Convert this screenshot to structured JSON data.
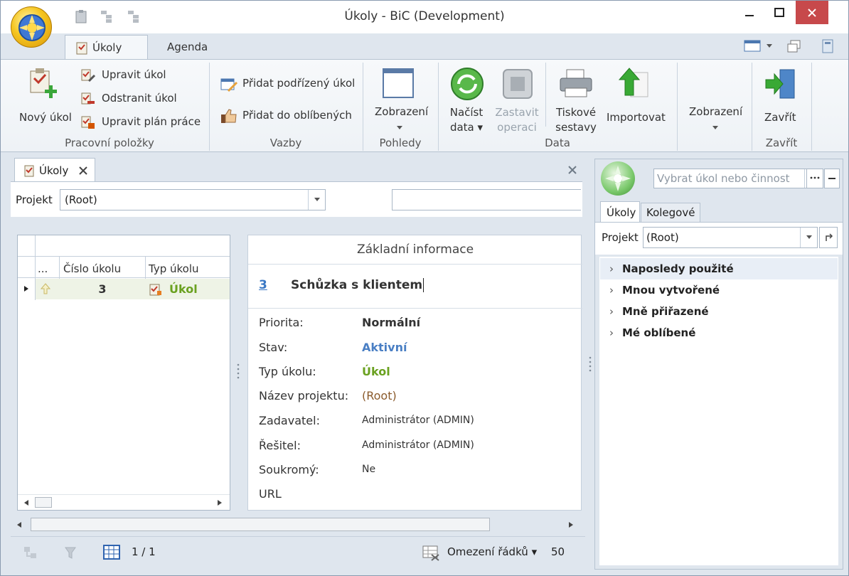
{
  "window": {
    "title": "Úkoly - BiC (Development)"
  },
  "ribbon": {
    "tabs": [
      {
        "label": "Úkoly"
      },
      {
        "label": "Agenda"
      }
    ],
    "groups": {
      "pracovni": {
        "label": "Pracovní položky",
        "new_task": "Nový úkol",
        "edit_task": "Upravit úkol",
        "delete_task": "Odstranit úkol",
        "edit_plan": "Upravit plán práce"
      },
      "vazby": {
        "label": "Vazby",
        "add_subtask": "Přidat podřízený úkol",
        "add_favorites": "Přidat do oblíbených"
      },
      "pohledy": {
        "label": "Pohledy",
        "view": "Zobrazení"
      },
      "data": {
        "label": "Data",
        "load_line1": "Načíst",
        "load_line2": "data",
        "stop_line1": "Zastavit",
        "stop_line2": "operaci",
        "print_line1": "Tiskové",
        "print_line2": "sestavy",
        "import": "Importovat"
      },
      "view2": {
        "view": "Zobrazení"
      },
      "zavrit": {
        "label": "Zavřít",
        "close": "Zavřít"
      }
    }
  },
  "document": {
    "tab_label": "Úkoly",
    "project_label": "Projekt",
    "project_value": "(Root)",
    "search_value": ""
  },
  "grid": {
    "headers": [
      "...",
      "Číslo úkolu",
      "Typ úkolu"
    ],
    "rows": [
      {
        "number": "3",
        "type": "Úkol"
      }
    ]
  },
  "detail": {
    "section_title": "Základní informace",
    "task_number": "3",
    "task_name": "Schůzka s klientem",
    "fields": [
      {
        "label": "Priorita:",
        "value": "Normální"
      },
      {
        "label": "Stav:",
        "value": "Aktivní"
      },
      {
        "label": "Typ úkolu:",
        "value": "Úkol"
      },
      {
        "label": "Název projektu:",
        "value": "(Root)"
      },
      {
        "label": "Zadavatel:",
        "value": "Administrátor (ADMIN)"
      },
      {
        "label": "Řešitel:",
        "value": "Administrátor (ADMIN)"
      },
      {
        "label": "Soukromý:",
        "value": "Ne"
      },
      {
        "label": "URL",
        "value": ""
      }
    ],
    "colors": {
      "link": "#3a78c4",
      "status": "#4a7fc4",
      "type": "#6aa120",
      "project": "#8a5a2b"
    }
  },
  "status": {
    "page": "1 / 1",
    "row_limit_label": "Omezení řádků",
    "row_limit_value": "50"
  },
  "right": {
    "search_placeholder": "Vybrat úkol nebo činnost",
    "tabs": [
      {
        "label": "Úkoly"
      },
      {
        "label": "Kolegové"
      }
    ],
    "project_label": "Projekt",
    "project_value": "(Root)",
    "tree": [
      {
        "label": "Naposledy použité"
      },
      {
        "label": "Mnou vytvořené"
      },
      {
        "label": "Mně přiřazené"
      },
      {
        "label": "Mé oblíbené"
      }
    ]
  }
}
